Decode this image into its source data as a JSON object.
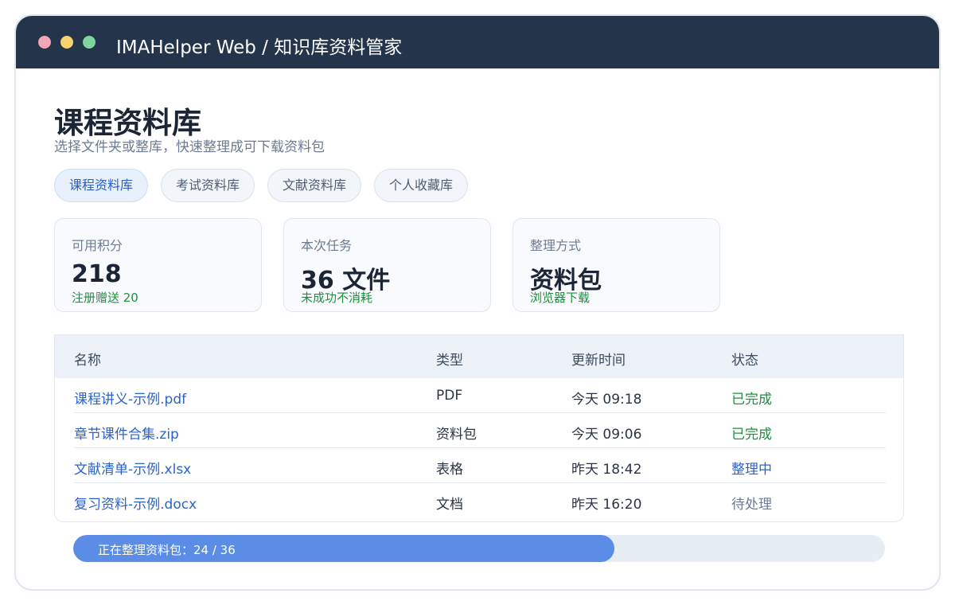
{
  "window": {
    "title": "IMAHelper Web / 知识库资料管家"
  },
  "page": {
    "title": "课程资料库",
    "subtitle": "选择文件夹或整库，快速整理成可下载资料包"
  },
  "tabs": [
    {
      "label": "课程资料库",
      "active": true
    },
    {
      "label": "考试资料库",
      "active": false
    },
    {
      "label": "文献资料库",
      "active": false
    },
    {
      "label": "个人收藏库",
      "active": false
    }
  ],
  "cards": [
    {
      "label": "可用积分",
      "value": "218",
      "note": "注册赠送 20"
    },
    {
      "label": "本次任务",
      "value": "36 文件",
      "note": "未成功不消耗"
    },
    {
      "label": "整理方式",
      "value": "资料包",
      "note": "浏览器下载"
    }
  ],
  "table": {
    "headers": [
      "名称",
      "类型",
      "更新时间",
      "状态"
    ],
    "rows": [
      {
        "name": "课程讲义-示例.pdf",
        "type": "PDF",
        "updated": "今天 09:18",
        "status": "已完成",
        "status_kind": "done"
      },
      {
        "name": "章节课件合集.zip",
        "type": "资料包",
        "updated": "今天 09:06",
        "status": "已完成",
        "status_kind": "done"
      },
      {
        "name": "文献清单-示例.xlsx",
        "type": "表格",
        "updated": "昨天 18:42",
        "status": "整理中",
        "status_kind": "progress"
      },
      {
        "name": "复习资料-示例.docx",
        "type": "文档",
        "updated": "昨天 16:20",
        "status": "待处理",
        "status_kind": "pending"
      }
    ]
  },
  "progress": {
    "label": "正在整理资料包：24 / 36",
    "done": 24,
    "total": 36
  },
  "colors": {
    "titlebar": "#24344b",
    "accent": "#2d63c8",
    "success": "#1e8f3e",
    "progress_fill": "#5b8de6"
  }
}
